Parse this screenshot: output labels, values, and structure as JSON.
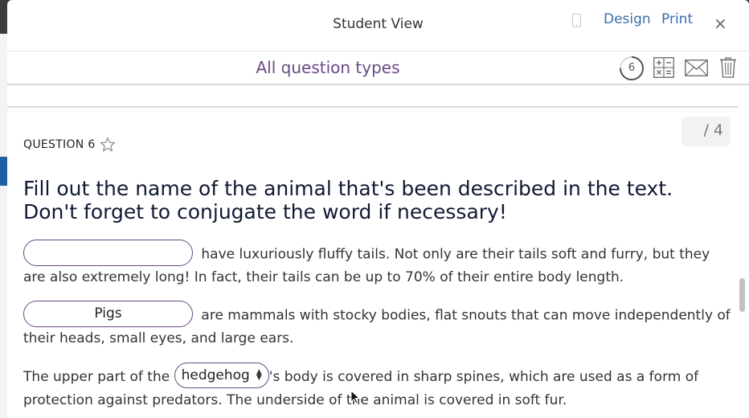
{
  "modal": {
    "title": "Student View",
    "design_label": "Design",
    "print_label": "Print",
    "close_label": "×"
  },
  "quiz": {
    "title": "All question types",
    "progress_count": "6",
    "progress_fraction": 0.75
  },
  "question": {
    "label": "QUESTION 6",
    "score": "/ 4",
    "prompt": "Fill out the name of the animal that's been described in the text. Don't forget to conjugate the word if necessary!",
    "paragraphs": [
      {
        "blank_value": "",
        "text": "have luxuriously fluffy tails. Not only are their tails soft and furry, but they are also extremely long! In fact, their tails can be up to 70% of their entire body length."
      },
      {
        "blank_value": "Pigs",
        "text": "are mammals with stocky bodies, flat snouts that can move independently of their heads, small eyes, and large ears."
      },
      {
        "before": "The upper part of the",
        "dropdown_value": "hedgehog",
        "after": "'s body is covered in sharp spines, which are used as a form of protection against predators. The underside of the animal is covered in soft fur."
      }
    ]
  },
  "colors": {
    "accent": "#6a4a86",
    "link": "#3b6ea8"
  },
  "icons": [
    "device-icon",
    "progress-ring-icon",
    "calculator-icon",
    "mail-icon",
    "trash-icon",
    "star-icon",
    "close-icon"
  ]
}
